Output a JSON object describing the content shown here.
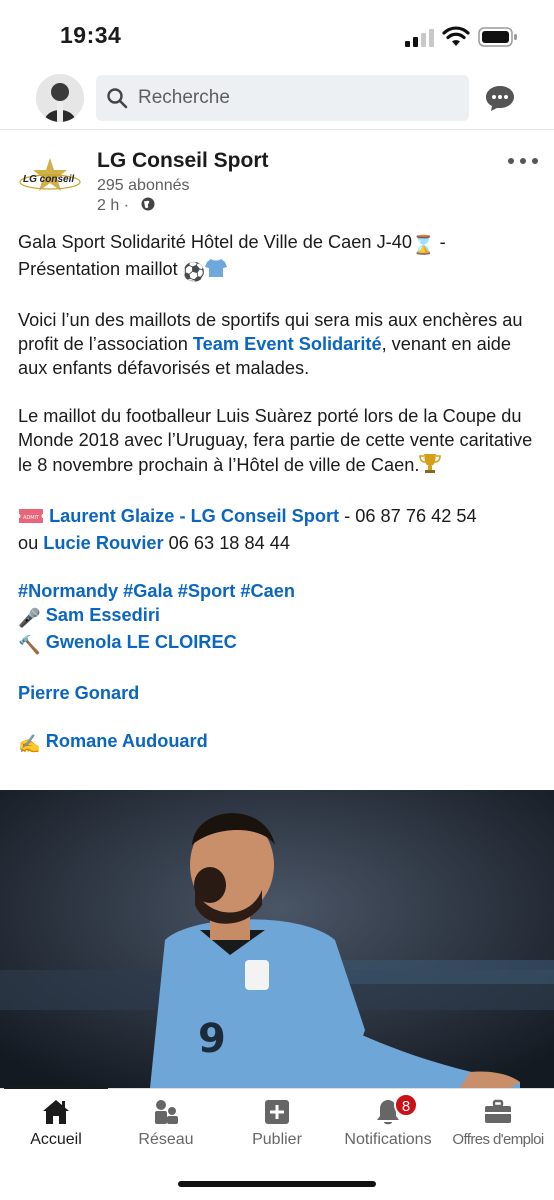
{
  "status_bar": {
    "time": "19:34"
  },
  "header": {
    "search_placeholder": "Recherche"
  },
  "post": {
    "company": {
      "name": "LG Conseil Sport",
      "logo_text": "LG conseil",
      "followers": "295 abonnés",
      "time": "2 h ·"
    },
    "title_line1": "Gala Sport Solidarité Hôtel de Ville de Caen J-40",
    "title_line1_suffix": " -",
    "title_line2": "Présentation maillot ",
    "para2_before": "Voici l’un des maillots de sportifs qui sera mis aux enchères au profit de l’association ",
    "para2_link": "Team Event Solidarité",
    "para2_after": ", venant en aide aux enfants défavorisés et malades.",
    "para3": "Le maillot du footballeur Luis Suàrez porté lors de la Coupe du Monde 2018 avec l’Uruguay, fera partie de cette vente caritative le 8 novembre prochain à l’Hôtel de ville de Caen.",
    "contact_link1": "Laurent Glaize",
    "contact_sep1": " - ",
    "contact_link2": "LG Conseil Sport",
    "contact_phone1": " - 06 87 76 42 54",
    "contact_or": "ou ",
    "contact_link3": "Lucie Rouvier",
    "contact_phone2": "  06 63 18 84 44",
    "hashtags": "#Normandy #Gala #Sport #Caen",
    "mention_mic": "Sam Essediri",
    "mention_hammer": "Gwenola LE CLOIREC",
    "mention_pierre": "Pierre Gonard",
    "mention_writing": "Romane Audouard"
  },
  "bottom_nav": {
    "items": [
      {
        "label": "Accueil",
        "icon": "home-icon"
      },
      {
        "label": "Réseau",
        "icon": "network-icon"
      },
      {
        "label": "Publier",
        "icon": "post-icon"
      },
      {
        "label": "Notifications",
        "icon": "bell-icon",
        "badge": "8"
      },
      {
        "label": "Offres d'emploi",
        "icon": "briefcase-icon"
      }
    ]
  },
  "colors": {
    "link": "#0a66c2",
    "badge": "#cc1016"
  }
}
